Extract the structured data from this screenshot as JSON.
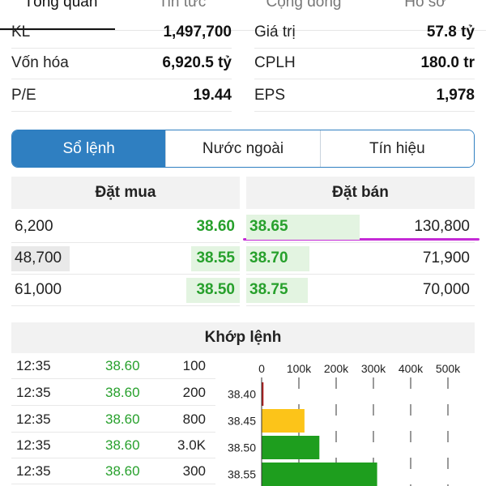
{
  "top_tabs": [
    {
      "label": "Tổng quan",
      "active": true
    },
    {
      "label": "Tin tức",
      "active": false
    },
    {
      "label": "Cộng đồng",
      "active": false
    },
    {
      "label": "Hồ sơ",
      "active": false
    }
  ],
  "stats": [
    {
      "left": {
        "label": "KL",
        "value": "1,497,700"
      },
      "right": {
        "label": "Giá trị",
        "value": "57.8 tỷ"
      }
    },
    {
      "left": {
        "label": "Vốn hóa",
        "value": "6,920.5 tỷ"
      },
      "right": {
        "label": "CPLH",
        "value": "180.0 tr"
      }
    },
    {
      "left": {
        "label": "P/E",
        "value": "19.44"
      },
      "right": {
        "label": "EPS",
        "value": "1,978"
      }
    }
  ],
  "segments": [
    {
      "label": "Sổ lệnh",
      "active": true
    },
    {
      "label": "Nước ngoài",
      "active": false
    },
    {
      "label": "Tín hiệu",
      "active": false
    }
  ],
  "order_book": {
    "buy_title": "Đặt mua",
    "sell_title": "Đặt bán",
    "buy": [
      {
        "volume": "6,200",
        "price": "38.60"
      },
      {
        "volume": "48,700",
        "price": "38.55"
      },
      {
        "volume": "61,000",
        "price": "38.50"
      }
    ],
    "sell": [
      {
        "price": "38.65",
        "volume": "130,800"
      },
      {
        "price": "38.70",
        "volume": "71,900"
      },
      {
        "price": "38.75",
        "volume": "70,000"
      }
    ]
  },
  "matched": {
    "title": "Khớp lệnh",
    "rows": [
      {
        "time": "12:35",
        "price": "38.60",
        "volume": "100"
      },
      {
        "time": "12:35",
        "price": "38.60",
        "volume": "200"
      },
      {
        "time": "12:35",
        "price": "38.60",
        "volume": "800"
      },
      {
        "time": "12:35",
        "price": "38.60",
        "volume": "3.0K"
      },
      {
        "time": "12:35",
        "price": "38.60",
        "volume": "300"
      }
    ]
  },
  "colors": {
    "accent": "#2f7fc1",
    "up_green": "#27a02c",
    "ref_yellow": "#fcc419",
    "down_red": "#b41e1e",
    "annotation": "#c42ad6"
  },
  "chart_data": {
    "type": "bar",
    "orientation": "horizontal",
    "x_ticks": [
      "0",
      "100k",
      "200k",
      "300k",
      "400k",
      "500k"
    ],
    "xlim": [
      0,
      500000
    ],
    "categories": [
      "38.40",
      "38.45",
      "38.50",
      "38.55"
    ],
    "values": [
      5000,
      115000,
      155000,
      310000
    ],
    "bar_colors": [
      "#b41e1e",
      "#fcc419",
      "#1e9e1e",
      "#1e9e1e"
    ],
    "grid": true
  }
}
